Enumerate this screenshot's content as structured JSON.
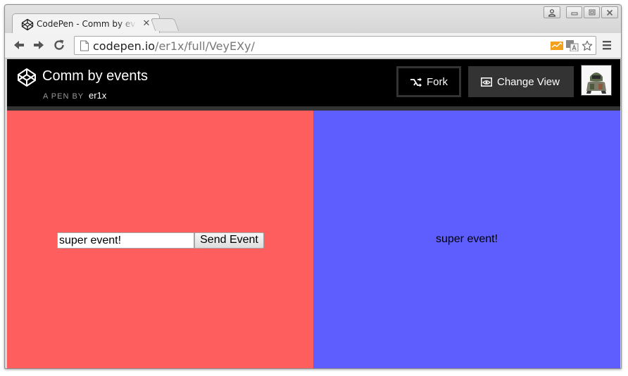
{
  "browser": {
    "tab_title": "CodePen - Comm by events",
    "tab_close": "✕",
    "url_host": "codepen.io",
    "url_path": "/er1x/full/VeyEXy/"
  },
  "header": {
    "pen_title": "Comm by events",
    "byline": "A PEN BY",
    "author": "er1x",
    "fork_label": "Fork",
    "change_view_label": "Change View"
  },
  "pen": {
    "input_value": "super event!",
    "send_button_label": "Send Event",
    "received_text": "super event!",
    "left_color": "#ff5e5e",
    "right_color": "#5e5eff"
  }
}
